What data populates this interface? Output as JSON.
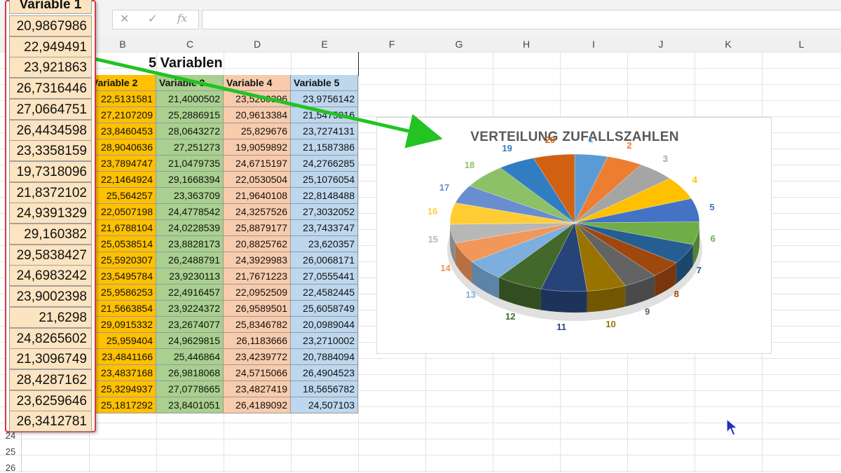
{
  "formula_bar": {
    "cancel": "✕",
    "enter": "✓",
    "fx": "fx",
    "value": ""
  },
  "columns": [
    "B",
    "C",
    "D",
    "E",
    "F",
    "G",
    "H",
    "I",
    "J",
    "K",
    "L"
  ],
  "sheet_title": "5 Variablen",
  "table": {
    "headers": [
      "Variable 2",
      "Variable 3",
      "Variable 4",
      "Variable 5"
    ],
    "rows": [
      [
        "22,5131581",
        "21,4000502",
        "23,5260396",
        "23,9756142"
      ],
      [
        "27,2107209",
        "25,2886915",
        "20,9613384",
        "21,5475816"
      ],
      [
        "23,8460453",
        "28,0643272",
        "25,829676",
        "23,7274131"
      ],
      [
        "28,9040636",
        "27,251273",
        "19,9059892",
        "21,1587386"
      ],
      [
        "23,7894747",
        "21,0479735",
        "24,6715197",
        "24,2766285"
      ],
      [
        "22,1464924",
        "29,1668394",
        "22,0530504",
        "25,1076054"
      ],
      [
        "25,564257",
        "23,363709",
        "21,9640108",
        "22,8148488"
      ],
      [
        "22,0507198",
        "24,4778542",
        "24,3257526",
        "27,3032052"
      ],
      [
        "21,6788104",
        "24,0228539",
        "25,8879177",
        "23,7433747"
      ],
      [
        "25,0538514",
        "23,8828173",
        "20,8825762",
        "23,620357"
      ],
      [
        "25,5920307",
        "26,2488791",
        "24,3929983",
        "26,0068171"
      ],
      [
        "23,5495784",
        "23,9230113",
        "21,7671223",
        "27,0555441"
      ],
      [
        "25,9586253",
        "22,4916457",
        "22,0952509",
        "22,4582445"
      ],
      [
        "21,5663854",
        "23,9224372",
        "26,9589501",
        "25,6058749"
      ],
      [
        "29,0915332",
        "23,2674077",
        "25,8346782",
        "20,0989044"
      ],
      [
        "25,959404",
        "24,9629815",
        "26,1183666",
        "23,2710002"
      ],
      [
        "23,4841166",
        "25,446864",
        "23,4239772",
        "20,7884094"
      ],
      [
        "23,4837168",
        "26,9818068",
        "24,5715066",
        "26,4904523"
      ],
      [
        "25,3294937",
        "27,0778665",
        "23,4827419",
        "18,5656782"
      ],
      [
        "25,1817292",
        "23,8401051",
        "26,4189092",
        "24,507103"
      ]
    ]
  },
  "row_numbers": [
    "24",
    "25",
    "26"
  ],
  "zoom_panel": {
    "header": "Variable 1",
    "values": [
      "20,9867986",
      "22,949491",
      "23,921863",
      "26,7316446",
      "27,0664751",
      "26,4434598",
      "23,3358159",
      "19,7318096",
      "21,8372102",
      "24,9391329",
      "29,160382",
      "29,5838427",
      "24,6983242",
      "23,9002398",
      "21,6298",
      "24,8265602",
      "21,3096749",
      "28,4287162",
      "23,6259646",
      "26,3412781"
    ]
  },
  "chart_data": {
    "type": "pie",
    "title": "VERTEILUNG ZUFALLSZAHLEN",
    "categories": [
      "1",
      "2",
      "3",
      "4",
      "5",
      "6",
      "7",
      "8",
      "9",
      "10",
      "11",
      "12",
      "13",
      "14",
      "15",
      "16",
      "17",
      "18",
      "19",
      "20"
    ],
    "values": [
      20.9867986,
      22.949491,
      23.921863,
      26.7316446,
      27.0664751,
      26.4434598,
      23.3358159,
      19.7318096,
      21.8372102,
      24.9391329,
      29.160382,
      29.5838427,
      24.6983242,
      23.9002398,
      21.6298,
      24.8265602,
      21.3096749,
      28.4287162,
      23.6259646,
      26.3412781
    ],
    "style": "3d",
    "colors": [
      "#5b9bd5",
      "#ed7d31",
      "#a5a5a5",
      "#ffc000",
      "#4472c4",
      "#70ad47",
      "#255e91",
      "#9e480e",
      "#636363",
      "#997300",
      "#264478",
      "#43682b",
      "#7cafdd",
      "#f1975a",
      "#b7b7b7",
      "#ffcd33",
      "#698ed0",
      "#8cc168",
      "#327dc2",
      "#d26012"
    ]
  },
  "colors": {
    "var1_fill": "#fce4c0",
    "var2_fill": "#ffc000",
    "var3_fill": "#a9d08e",
    "var4_fill": "#f8cbad",
    "var5_fill": "#bdd7ee",
    "panel_border": "#d43a3a",
    "arrow": "#22c322"
  }
}
